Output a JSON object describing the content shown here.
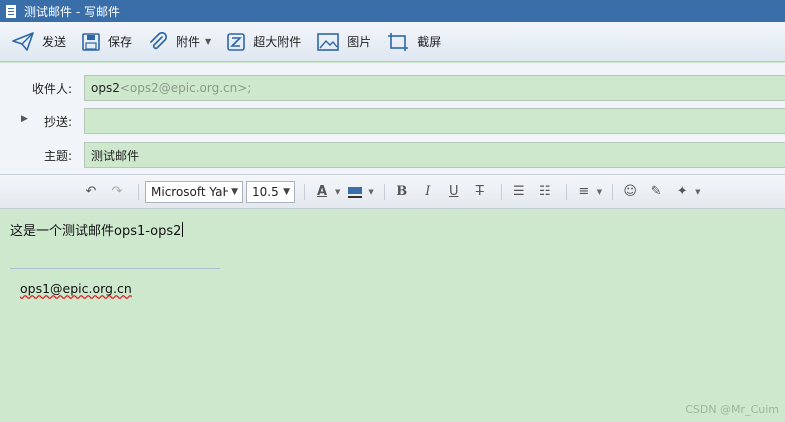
{
  "window": {
    "title": "测试邮件 - 写邮件"
  },
  "toolbar": {
    "send": {
      "label": "发送",
      "icon": "paper-plane-icon"
    },
    "save": {
      "label": "保存",
      "icon": "floppy-disk-icon"
    },
    "attach": {
      "label": "附件",
      "icon": "paperclip-icon"
    },
    "big_attach": {
      "label": "超大附件",
      "icon": "zip-file-icon"
    },
    "image": {
      "label": "图片",
      "icon": "image-icon"
    },
    "screenshot": {
      "label": "截屏",
      "icon": "crop-icon"
    }
  },
  "fields": {
    "to": {
      "label": "收件人:",
      "name": "ops2",
      "address": "<ops2@epic.org.cn>;"
    },
    "cc": {
      "label": "抄送:",
      "value": ""
    },
    "subject": {
      "label": "主题:",
      "value": "测试邮件"
    }
  },
  "format": {
    "font_family": "Microsoft YaH",
    "font_size": "10.5"
  },
  "editor": {
    "body": "这是一个测试邮件ops1-ops2",
    "signature": "ops1@epic.org.cn"
  },
  "watermark": "CSDN @Mr_Cuim",
  "colors": {
    "accent": "#3a6ea8",
    "editor_bg": "#cde8cd",
    "toolbar_icon": "#2e67a7"
  }
}
